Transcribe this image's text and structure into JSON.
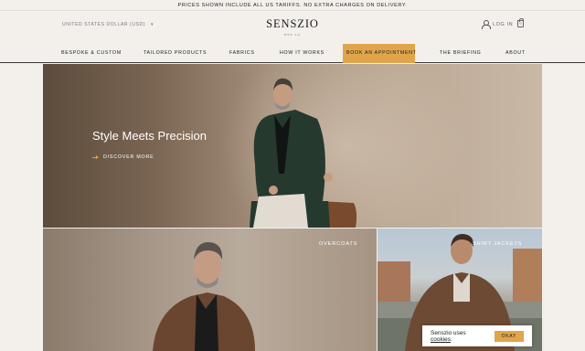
{
  "announcement": "PRICES SHOWN INCLUDE ALL US TARIFFS. NO EXTRA CHARGES ON DELIVERY.",
  "header": {
    "currency": "UNITED STATES DOLLAR (USD)",
    "brand": "SENSZIO",
    "brand_sub": "EST.14",
    "login": "LOG IN",
    "cart_count": "0"
  },
  "nav": {
    "items": [
      {
        "label": "BESPOKE & CUSTOM"
      },
      {
        "label": "TAILORED PRODUCTS"
      },
      {
        "label": "FABRICS"
      },
      {
        "label": "HOW IT WORKS"
      },
      {
        "label": "BOOK AN APPOINTMENT"
      },
      {
        "label": "THE BRIEFING"
      },
      {
        "label": "ABOUT"
      }
    ]
  },
  "hero": {
    "title": "Style Meets Precision",
    "cta": "DISCOVER MORE"
  },
  "tiles": [
    {
      "label": "OVERCOATS"
    },
    {
      "label": "SHIRT JACKETS"
    }
  ],
  "cookie": {
    "message_prefix": "Senszio uses ",
    "link": "cookies",
    "message_suffix": ".",
    "button": "OKAY"
  },
  "colors": {
    "accent": "#e0a54b",
    "background": "#f3f0ec"
  }
}
